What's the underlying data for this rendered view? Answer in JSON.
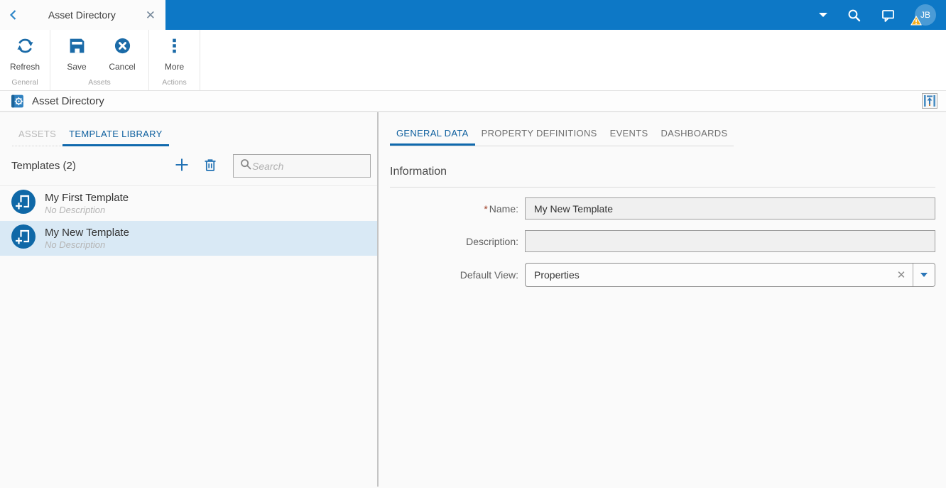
{
  "titlebar": {
    "tab_title": "Asset Directory",
    "user_initials": "JB"
  },
  "ribbon": {
    "buttons": [
      {
        "label": "Refresh"
      },
      {
        "label": "Save"
      },
      {
        "label": "Cancel"
      },
      {
        "label": "More"
      }
    ],
    "groups": [
      "General",
      "Assets",
      "Actions"
    ]
  },
  "page_header": {
    "title": "Asset Directory"
  },
  "left_panel": {
    "tabs": [
      {
        "label": "ASSETS"
      },
      {
        "label": "TEMPLATE LIBRARY"
      }
    ],
    "list_title": "Templates (2)",
    "search_placeholder": "Search",
    "items": [
      {
        "title": "My First Template",
        "subtitle": "No Description"
      },
      {
        "title": "My New Template",
        "subtitle": "No Description"
      }
    ]
  },
  "right_panel": {
    "tabs": [
      {
        "label": "GENERAL DATA"
      },
      {
        "label": "PROPERTY DEFINITIONS"
      },
      {
        "label": "EVENTS"
      },
      {
        "label": "DASHBOARDS"
      }
    ],
    "section_title": "Information",
    "required_marker": "*",
    "fields": {
      "name": {
        "label": "Name:",
        "value": "My New Template"
      },
      "description": {
        "label": "Description:",
        "value": ""
      },
      "default_view": {
        "label": "Default View:",
        "value": "Properties"
      }
    }
  },
  "icons": {
    "topbar": [
      "back-icon",
      "caret-down-icon",
      "search-icon",
      "chat-icon",
      "user-avatar",
      "warning-badge-icon",
      "tab-close-icon"
    ],
    "ribbon": [
      "refresh-icon",
      "save-icon",
      "cancel-icon",
      "more-icon"
    ],
    "header": [
      "asset-directory-icon",
      "expand-panel-icon"
    ],
    "left_panel": [
      "add-icon",
      "trash-icon",
      "search-field-icon",
      "template-icon"
    ],
    "combo": [
      "clear-icon",
      "dropdown-icon"
    ]
  },
  "colors": {
    "topbar_blue": "#0d78c6",
    "icon_blue": "#1b6ba8",
    "accent_underline": "#1069ad",
    "active_tab_text": "#0d5f9e",
    "selected_row": "#d9e9f5",
    "avatar_blue": "#4a9bd6",
    "warning_yellow": "#f2ac1c",
    "input_bg": "#f0f0f0",
    "required_red": "#9c3b23"
  }
}
